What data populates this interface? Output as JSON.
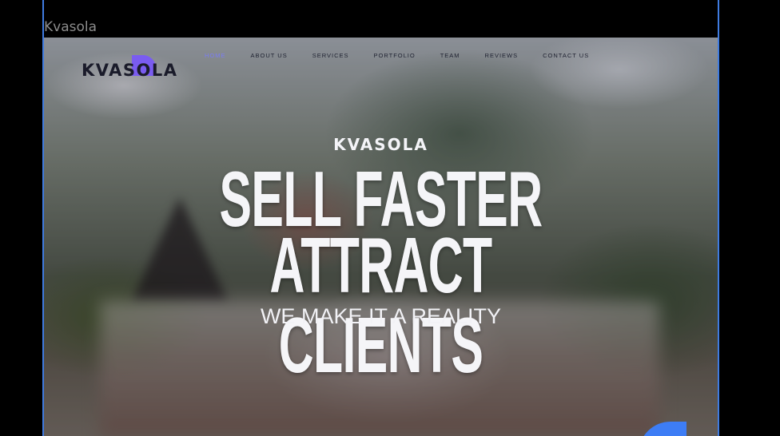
{
  "frame": {
    "label": "Kvasola"
  },
  "nav": {
    "logo_text": "KVASOLA",
    "items": [
      {
        "label": "HOME",
        "active": true
      },
      {
        "label": "ABOUT US",
        "active": false
      },
      {
        "label": "SERVICES",
        "active": false
      },
      {
        "label": "PORTFOLIO",
        "active": false
      },
      {
        "label": "TEAM",
        "active": false
      },
      {
        "label": "REVIEWS",
        "active": false
      },
      {
        "label": "CONTACT US",
        "active": false
      }
    ]
  },
  "hero": {
    "brand": "KVASOLA",
    "headline_line1": "SELL FASTER",
    "headline_line2": "ATTRACT CLIENTS",
    "tagline": "WE MAKE IT A REALITY"
  },
  "colors": {
    "accent": "#7a7cf5",
    "logo_mark": "#7a5cf0",
    "frame_outline": "#3f7be0",
    "corner_shape": "#3d7df5"
  }
}
